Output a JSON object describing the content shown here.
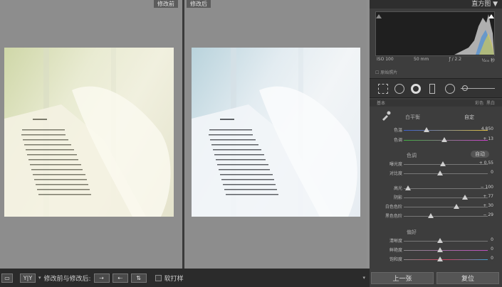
{
  "compare": {
    "before_label": "修改前",
    "after_label": "修改后"
  },
  "toolbar": {
    "view_label": "Y|Y",
    "mode_label": "修改前与修改后:",
    "soft_proof_label": "软打样"
  },
  "panel": {
    "histogram_title": "直方图",
    "exif": {
      "iso": "ISO 100",
      "focal": "50 mm",
      "aperture": "ƒ / 2.2",
      "shutter": "¹⁄₂₀₀ 秒"
    },
    "original_photo_label": "原始照片",
    "basic_title": "基本",
    "basic_mode_left": "彩色",
    "basic_mode_right": "黑白",
    "wb_label": "白平衡",
    "wb_value": "自定",
    "temp_label": "色温",
    "temp_value": "4,850",
    "tint_label": "色调",
    "tint_value": "+ 13",
    "tone_label": "色调",
    "auto_label": "自动",
    "exposure_label": "曝光度",
    "exposure_value": "+ 0.55",
    "contrast_label": "对比度",
    "contrast_value": "0",
    "highlights_label": "高光",
    "highlights_value": "− 100",
    "shadows_label": "阴影",
    "shadows_value": "+ 77",
    "whites_label": "白色色阶",
    "whites_value": "+ 30",
    "blacks_label": "黑色色阶",
    "blacks_value": "− 29",
    "presence_label": "偏好",
    "clarity_label": "清晰度",
    "clarity_value": "0",
    "vibrance_label": "鲜艳度",
    "vibrance_value": "0",
    "saturation_label": "饱和度",
    "saturation_value": "0",
    "prev_button": "上一张",
    "reset_button": "复位"
  }
}
